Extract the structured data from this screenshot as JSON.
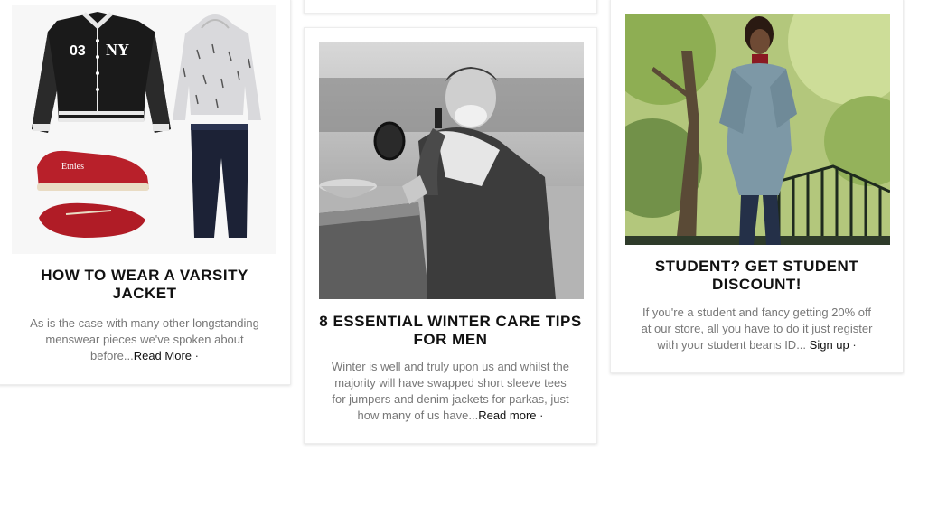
{
  "cards": [
    {
      "title": "HOW TO WEAR A VARSITY JACKET",
      "excerpt": "As is the case with many other longstanding menswear pieces we've spoken about before...",
      "link": "Read More",
      "dot": "·",
      "image": {
        "jacket_number": "03",
        "jacket_logo": "NY",
        "shoe_brand": "Etnies"
      }
    },
    {
      "title": "8 ESSENTIAL WINTER CARE TIPS FOR MEN",
      "excerpt": "Winter is well and truly upon us and whilst the majority will have swapped short sleeve tees for jumpers and denim jackets for parkas, just how many of us have...",
      "link": "Read more",
      "dot": "·"
    },
    {
      "title": "STUDENT? GET STUDENT DISCOUNT!",
      "excerpt": "If you're a student and fancy getting 20% off at our store, all you have to do it just register with your student beans ID... ",
      "link": "Sign up",
      "dot": "·"
    }
  ]
}
